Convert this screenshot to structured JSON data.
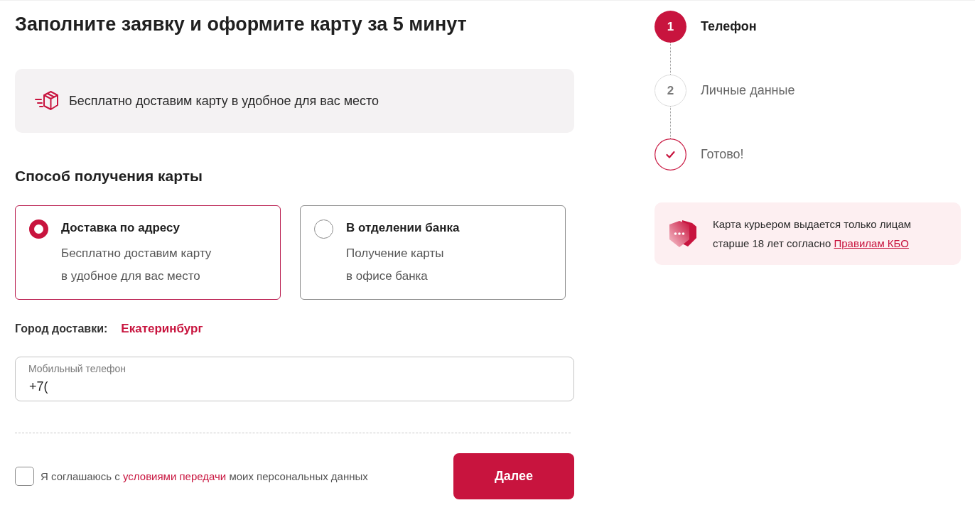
{
  "heading": "Заполните заявку и оформите карту за 5 минут",
  "promo": {
    "text": "Бесплатно доставим карту в удобное для вас место"
  },
  "delivery": {
    "title": "Способ получения карты",
    "options": [
      {
        "title": "Доставка по адресу",
        "description_lines": [
          "Бесплатно доставим карту",
          "в удобное для вас место"
        ],
        "selected": true
      },
      {
        "title": "В отделении банка",
        "description_lines": [
          "Получение карты",
          "в офисе банка"
        ],
        "selected": false
      }
    ]
  },
  "city": {
    "label": "Город доставки:",
    "value": "Екатеринбург"
  },
  "phone_field": {
    "label": "Мобильный телефон",
    "value": "+7("
  },
  "consent": {
    "checked": false,
    "prefix": "Я соглашаюсь с",
    "link": "условиями передачи",
    "suffix": "моих персональных данных"
  },
  "submit_button": {
    "label": "Далее"
  },
  "steps": [
    {
      "kind": "number",
      "marker": "1",
      "label": "Телефон",
      "selected": true
    },
    {
      "kind": "number",
      "marker": "2",
      "label": "Личные данные",
      "selected": false
    },
    {
      "kind": "finish",
      "label": "Готово!",
      "selected": false
    }
  ],
  "notice": {
    "text": "Карта курьером выдается только лицам старше 18 лет согласно",
    "link": "Правилам КБО"
  }
}
